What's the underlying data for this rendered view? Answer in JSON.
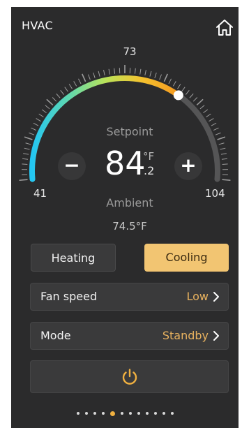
{
  "header": {
    "title": "HVAC",
    "home_icon": "home-icon"
  },
  "gauge": {
    "min_label": "41",
    "max_label": "104",
    "mid_label": "73",
    "min": 41,
    "max": 104,
    "setpoint": 84.2,
    "gradient_colors": [
      "#23c6f2",
      "#5fd8b0",
      "#b9e35a",
      "#f5c22e",
      "#f59a20"
    ],
    "track_color": "#555556",
    "tick_color": "#9c9c9c"
  },
  "setpoint": {
    "label": "Setpoint",
    "whole": "84",
    "fraction": ".2",
    "unit": "°F",
    "decrease_label": "−",
    "increase_label": "+"
  },
  "ambient": {
    "label": "Ambient",
    "value": "74.5°F"
  },
  "modes": {
    "heating_label": "Heating",
    "cooling_label": "Cooling",
    "selected": "Cooling",
    "accent_color": "#f2c572"
  },
  "fan": {
    "label": "Fan speed",
    "value": "Low"
  },
  "mode": {
    "label": "Mode",
    "value": "Standby"
  },
  "power": {
    "icon": "power-icon",
    "color": "#f0b040"
  },
  "pager": {
    "count": 12,
    "active_index": 4
  }
}
